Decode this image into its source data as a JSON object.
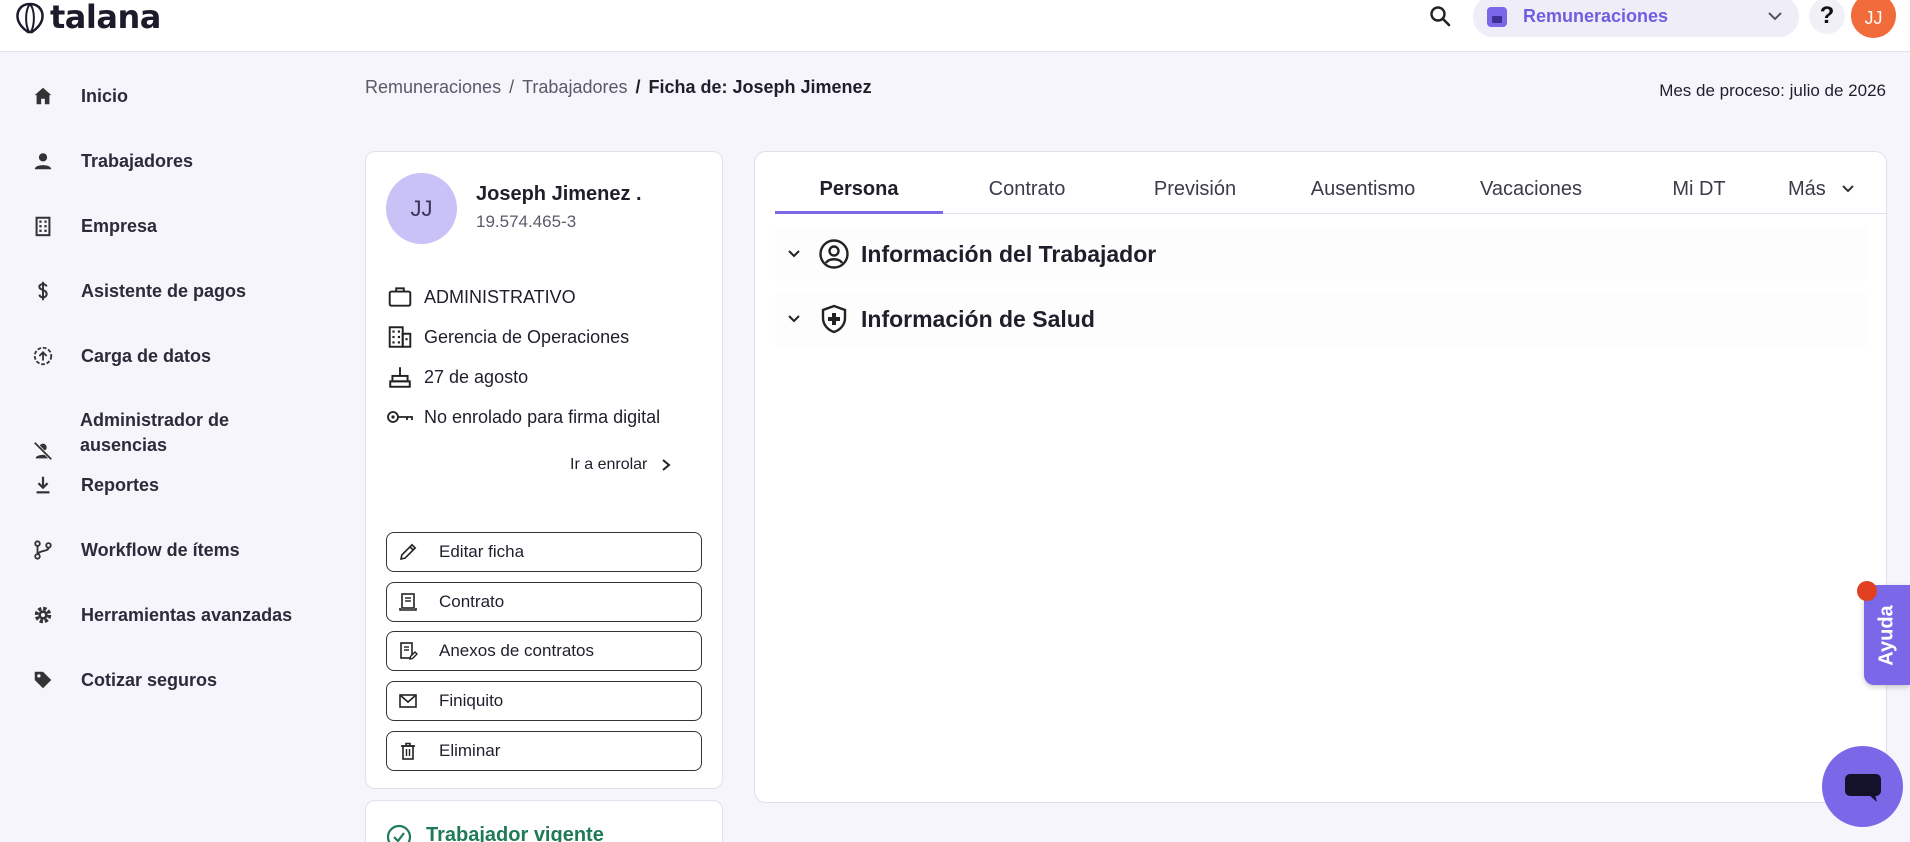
{
  "header": {
    "logo_text": "talana",
    "module": "Remuneraciones",
    "help_label": "?",
    "user_initials": "JJ"
  },
  "sidebar": {
    "items": [
      {
        "label": "Inicio",
        "icon": "home-icon"
      },
      {
        "label": "Trabajadores",
        "icon": "person-icon"
      },
      {
        "label": "Empresa",
        "icon": "building-icon"
      },
      {
        "label": "Asistente de pagos",
        "icon": "dollar-icon"
      },
      {
        "label": "Carga de datos",
        "icon": "upload-icon"
      },
      {
        "label": "Administrador de ausencias",
        "icon": "person-off-icon"
      },
      {
        "label": "Reportes",
        "icon": "download-icon"
      },
      {
        "label": "Workflow de ítems",
        "icon": "workflow-icon"
      },
      {
        "label": "Herramientas avanzadas",
        "icon": "gear-icon"
      },
      {
        "label": "Cotizar seguros",
        "icon": "tag-icon"
      }
    ]
  },
  "breadcrumb": {
    "items": [
      "Remuneraciones",
      "Trabajadores"
    ],
    "separator": "/",
    "current": "Ficha de: Joseph Jimenez"
  },
  "process_month": "Mes de proceso: julio de 2026",
  "profile": {
    "initials": "JJ",
    "name": "Joseph Jimenez .",
    "rut": "19.574.465-3",
    "info": [
      {
        "text": "ADMINISTRATIVO",
        "icon": "briefcase-icon"
      },
      {
        "text": "Gerencia de Operaciones",
        "icon": "building-icon"
      },
      {
        "text": "27 de agosto",
        "icon": "cake-icon"
      },
      {
        "text": "No enrolado para firma digital",
        "icon": "key-icon"
      }
    ],
    "enroll_link": "Ir a enrolar",
    "actions": [
      {
        "label": "Editar ficha",
        "icon": "pencil-icon"
      },
      {
        "label": "Contrato",
        "icon": "document-icon"
      },
      {
        "label": "Anexos de contratos",
        "icon": "document-edit-icon"
      },
      {
        "label": "Finiquito",
        "icon": "mail-icon"
      },
      {
        "label": "Eliminar",
        "icon": "trash-icon"
      }
    ],
    "status": "Trabajador vigente"
  },
  "tabs": {
    "items": [
      "Persona",
      "Contrato",
      "Previsión",
      "Ausentismo",
      "Vacaciones",
      "Mi DT"
    ],
    "more": "Más",
    "active": "Persona"
  },
  "sections": [
    {
      "title": "Información del Trabajador",
      "icon": "person-circle-icon"
    },
    {
      "title": "Información de Salud",
      "icon": "shield-plus-icon"
    }
  ],
  "floating": {
    "help_tab": "Ayuda"
  },
  "colors": {
    "accent": "#7b68e8",
    "avatar_orange": "#f26b3a",
    "status_green": "#1f7a56",
    "notification_red": "#e0401f"
  }
}
